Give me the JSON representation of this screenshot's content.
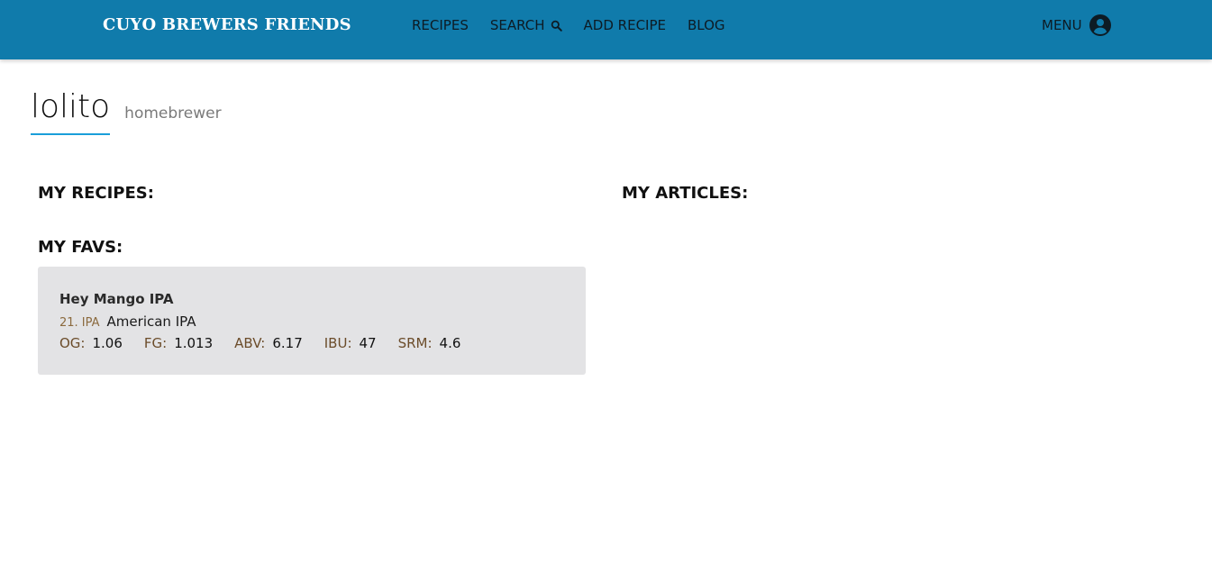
{
  "navbar": {
    "brand": "CUYO BREWERS FRIENDS",
    "links": [
      "RECIPES",
      "SEARCH",
      "ADD RECIPE",
      "BLOG"
    ],
    "menu_label": "MENU",
    "accent_color": "#107bab"
  },
  "profile": {
    "username": "lolito",
    "role": "homebrewer"
  },
  "sections": {
    "my_recipes": "MY RECIPES:",
    "my_favs": "MY FAVS:",
    "my_articles": "MY ARTICLES:"
  },
  "favs": [
    {
      "name": "Hey Mango IPA",
      "style_code": "21. IPA",
      "style_name": "American IPA",
      "stats": [
        {
          "label": "OG:",
          "value": "1.06"
        },
        {
          "label": "FG:",
          "value": "1.013"
        },
        {
          "label": "ABV:",
          "value": "6.17"
        },
        {
          "label": "IBU:",
          "value": "47"
        },
        {
          "label": "SRM:",
          "value": "4.6"
        }
      ]
    }
  ],
  "icons": {
    "search": "search-icon",
    "account": "account-circle-icon"
  }
}
